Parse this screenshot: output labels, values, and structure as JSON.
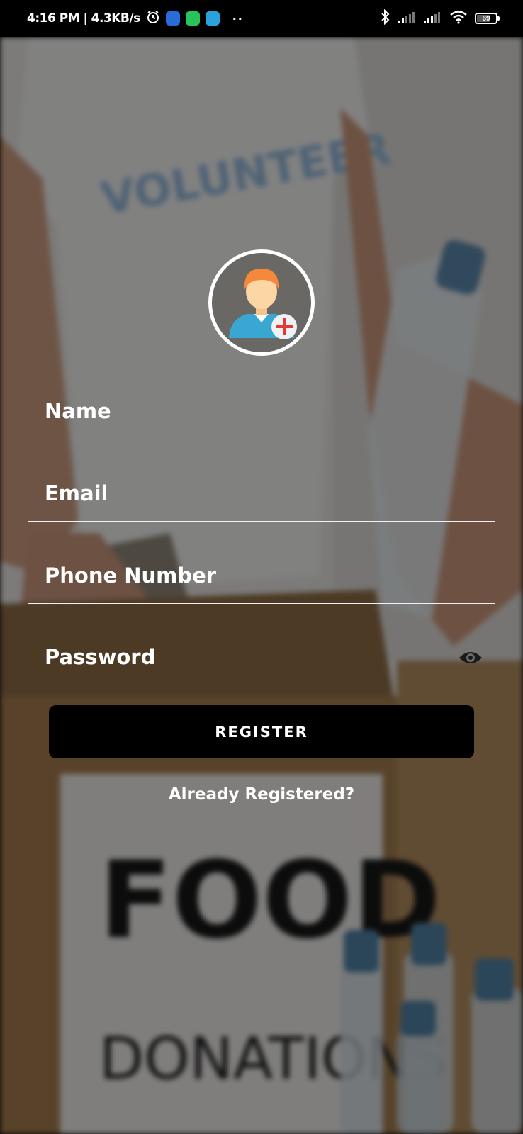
{
  "status_bar": {
    "time_speed": "4:16 PM | 4.3KB/s",
    "more_indicator": "··",
    "battery_level": "69",
    "icons": [
      "alarm-icon",
      "messages-app-icon",
      "whatsapp-icon",
      "telegram-icon",
      "bluetooth-icon",
      "signal-icon",
      "signal-icon",
      "wifi-icon",
      "battery-icon"
    ]
  },
  "background": {
    "shirt_text": "VOLUNTEER",
    "sign_title": "FOOD",
    "sign_subtitle": "DONATIONS"
  },
  "form": {
    "avatar": "add-profile-photo-icon",
    "name_placeholder": "Name",
    "email_placeholder": "Email",
    "phone_placeholder": "Phone Number",
    "password_placeholder": "Password",
    "name_value": "",
    "email_value": "",
    "phone_value": "",
    "password_value": "",
    "register_label": "Register",
    "login_link": "Already Registered?"
  },
  "colors": {
    "button": "#000000",
    "field_line": "#f2f2f2",
    "avatar_shirt": "#3aa7d3",
    "avatar_hair": "#f6883c",
    "add_badge": "#e53935"
  }
}
